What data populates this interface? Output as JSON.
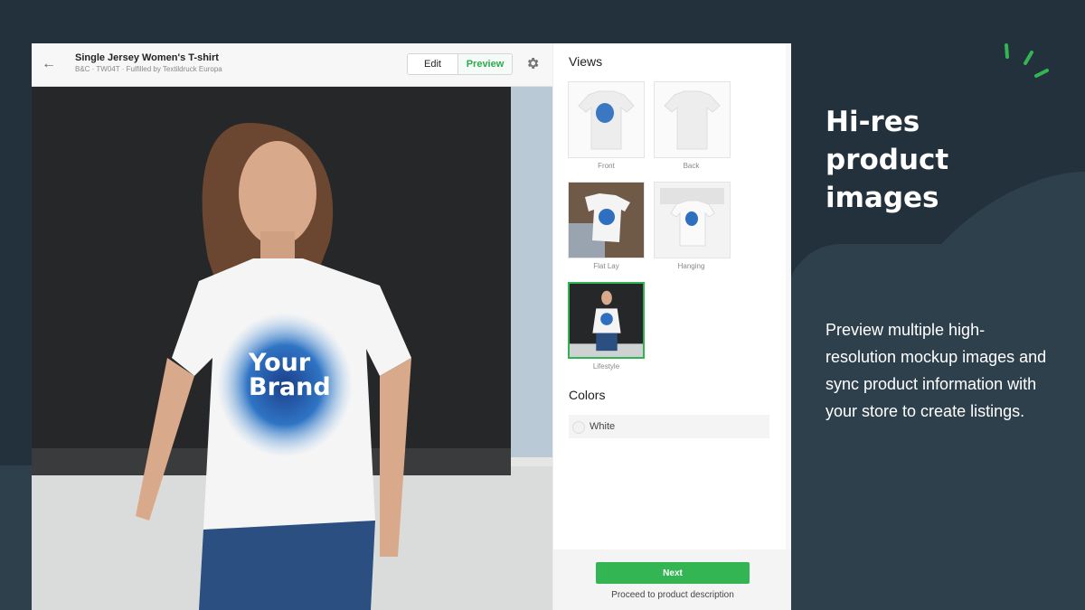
{
  "product": {
    "title": "Single Jersey Women's T-shirt",
    "subtitle": "B&C · TW04T · Fulfilled by Textildruck Europa"
  },
  "toolbar": {
    "edit_label": "Edit",
    "preview_label": "Preview"
  },
  "mockup": {
    "shirt_text_line1": "Your",
    "shirt_text_line2": "Brand"
  },
  "views": {
    "heading": "Views",
    "items": [
      {
        "label": "Front"
      },
      {
        "label": "Back"
      },
      {
        "label": "Flat Lay"
      },
      {
        "label": "Hanging"
      },
      {
        "label": "Lifestyle"
      }
    ],
    "selected": "Lifestyle"
  },
  "colors": {
    "heading": "Colors",
    "items": [
      {
        "label": "White",
        "swatch": "#f2f2f2"
      }
    ]
  },
  "footer": {
    "next_label": "Next",
    "next_sub": "Proceed to product description"
  },
  "marketing": {
    "headline_line1": "Hi-res",
    "headline_line2": "product",
    "headline_line3": "images",
    "description": "Preview multiple high-resolution mockup images and sync product information with your store to create listings."
  },
  "theme": {
    "accent": "#33b553",
    "background": "#22313b"
  }
}
